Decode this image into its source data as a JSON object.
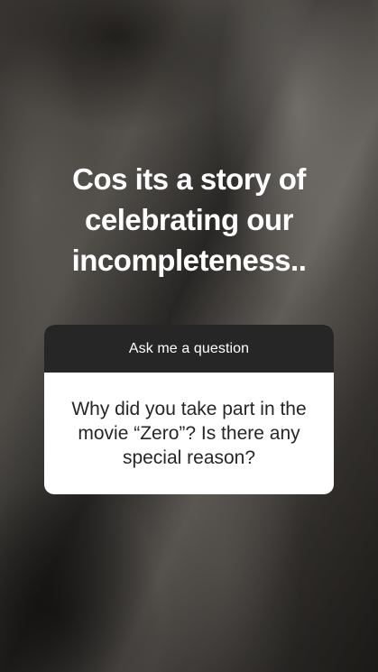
{
  "story": {
    "answer_text": "Cos its a story of\ncelebrating our\nincompleteness..",
    "question_sticker": {
      "header_label": "Ask me a question",
      "question": "Why did you take part in the movie “Zero”? Is there any special reason?"
    }
  },
  "colors": {
    "card_header_bg": "#262626",
    "card_body_bg": "#ffffff",
    "answer_text": "#ffffff",
    "question_text": "#262626"
  }
}
